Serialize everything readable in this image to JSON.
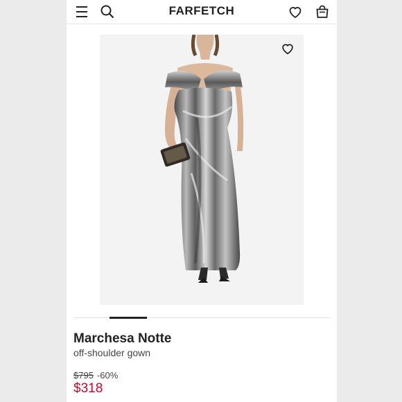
{
  "header": {
    "logo_text": "FARFETCH",
    "icons": [
      "menu-icon",
      "search-icon",
      "heart-icon",
      "bag-icon"
    ]
  },
  "product": {
    "brand": "Marchesa Notte",
    "description": "off-shoulder gown",
    "original_price": "$795",
    "discount": "-60%",
    "sale_price": "$318",
    "sale_color": "#d6002a"
  },
  "gallery": {
    "active_index": 2,
    "image_subject": "silver metallic off-shoulder gown"
  }
}
